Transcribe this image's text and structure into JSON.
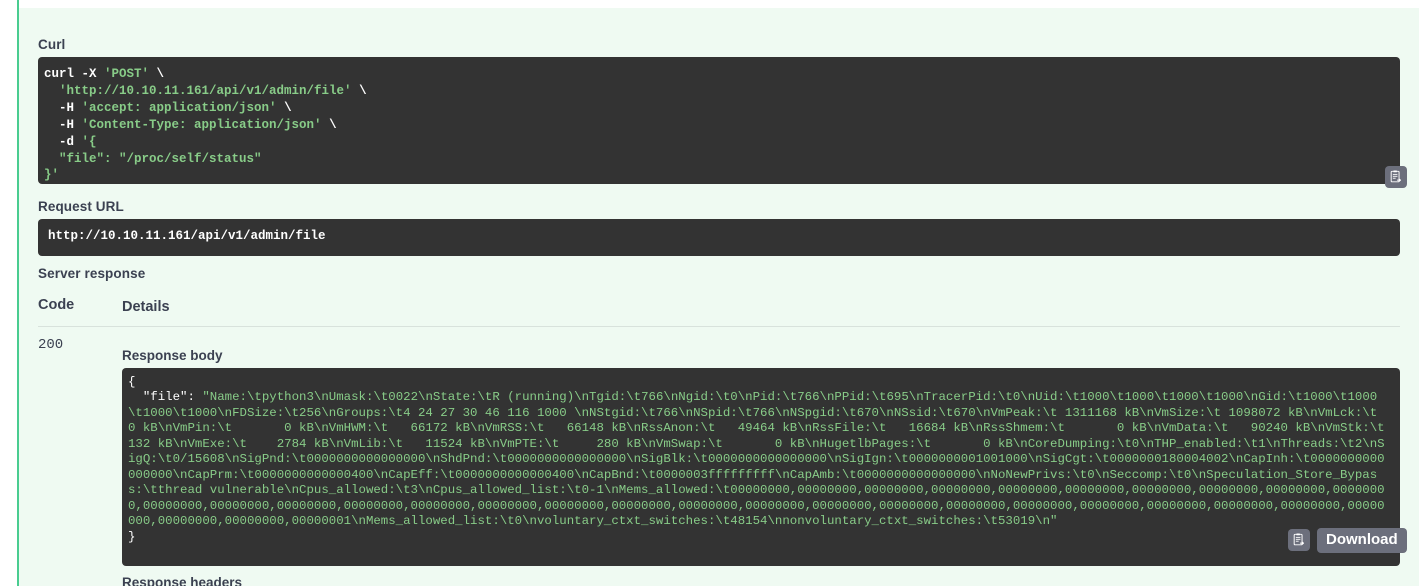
{
  "sections": {
    "curl_title": "Curl",
    "request_url_title": "Request URL",
    "server_response_title": "Server response",
    "response_body_label": "Response body",
    "response_headers_label": "Response headers"
  },
  "curl": {
    "line1_cmd": "curl -X ",
    "line1_method": "'POST'",
    "line1_cont": " \\",
    "line2_url": "  'http://10.10.11.161/api/v1/admin/file'",
    "line2_cont": " \\",
    "line3_flag": "  -H ",
    "line3_val": "'accept: application/json'",
    "line3_cont": " \\",
    "line4_flag": "  -H ",
    "line4_val": "'Content-Type: application/json'",
    "line4_cont": " \\",
    "line5_flag": "  -d ",
    "line5_val": "'{",
    "line6": "  \"file\": \"/proc/self/status\"",
    "line7": "}'"
  },
  "request_url": {
    "value": "http://10.10.11.161/api/v1/admin/file"
  },
  "response_table": {
    "headers": {
      "code": "Code",
      "details": "Details"
    },
    "row": {
      "code": "200"
    }
  },
  "response_body": {
    "open_brace": "{",
    "key": "  \"file\": ",
    "value": "\"Name:\\tpython3\\nUmask:\\t0022\\nState:\\tR (running)\\nTgid:\\t766\\nNgid:\\t0\\nPid:\\t766\\nPPid:\\t695\\nTracerPid:\\t0\\nUid:\\t1000\\t1000\\t1000\\t1000\\nGid:\\t1000\\t1000\\t1000\\t1000\\nFDSize:\\t256\\nGroups:\\t4 24 27 30 46 116 1000 \\nNStgid:\\t766\\nNSpid:\\t766\\nNSpgid:\\t670\\nNSsid:\\t670\\nVmPeak:\\t 1311168 kB\\nVmSize:\\t 1098072 kB\\nVmLck:\\t       0 kB\\nVmPin:\\t       0 kB\\nVmHWM:\\t   66172 kB\\nVmRSS:\\t   66148 kB\\nRssAnon:\\t   49464 kB\\nRssFile:\\t   16684 kB\\nRssShmem:\\t       0 kB\\nVmData:\\t   90240 kB\\nVmStk:\\t     132 kB\\nVmExe:\\t    2784 kB\\nVmLib:\\t   11524 kB\\nVmPTE:\\t     280 kB\\nVmSwap:\\t       0 kB\\nHugetlbPages:\\t       0 kB\\nCoreDumping:\\t0\\nTHP_enabled:\\t1\\nThreads:\\t2\\nSigQ:\\t0/15608\\nSigPnd:\\t0000000000000000\\nShdPnd:\\t0000000000000000\\nSigBlk:\\t0000000000000000\\nSigIgn:\\t0000000001001000\\nSigCgt:\\t0000000180004002\\nCapInh:\\t0000000000000000\\nCapPrm:\\t0000000000000400\\nCapEff:\\t0000000000000400\\nCapBnd:\\t0000003fffffffff\\nCapAmb:\\t0000000000000000\\nNoNewPrivs:\\t0\\nSeccomp:\\t0\\nSpeculation_Store_Bypass:\\tthread vulnerable\\nCpus_allowed:\\t3\\nCpus_allowed_list:\\t0-1\\nMems_allowed:\\t00000000,00000000,00000000,00000000,00000000,00000000,00000000,00000000,00000000,00000000,00000000,00000000,00000000,00000000,00000000,00000000,00000000,00000000,00000000,00000000,00000000,00000000,00000000,00000000,00000000,00000000,00000000,00000000,00000000,00000000,00000000,00000001\\nMems_allowed_list:\\t0\\nvoluntary_ctxt_switches:\\t48154\\nnonvoluntary_ctxt_switches:\\t53019\\n\"",
    "close_brace": "}"
  },
  "buttons": {
    "download_label": "Download",
    "copy_curl_icon": "copy-to-clipboard-icon",
    "copy_response_icon": "copy-to-clipboard-icon"
  },
  "colors": {
    "accent_green": "#49cc90",
    "panel_bg": "#effaf2",
    "code_bg": "#333333",
    "code_string": "#88cc88",
    "button_gray": "#6c6f7c",
    "text_dark": "#3b4151"
  }
}
